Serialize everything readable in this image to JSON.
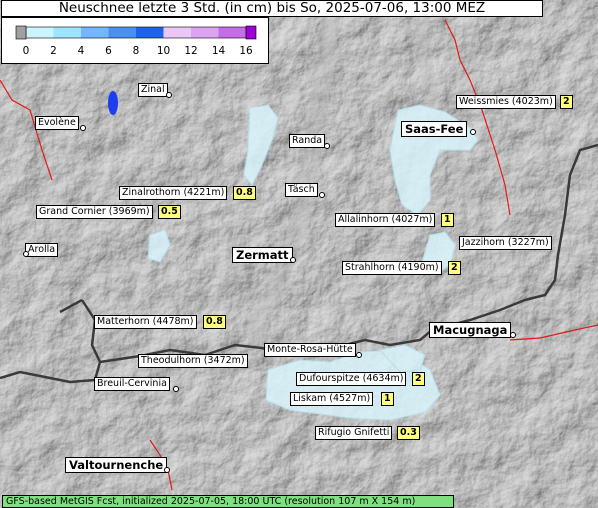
{
  "title": "Neuschnee letzte 3 Std. (in cm) bis So, 2025-07-06, 13:00 MEZ",
  "legend": {
    "ticks": [
      "0",
      "2",
      "4",
      "6",
      "8",
      "10",
      "12",
      "14",
      "16"
    ],
    "colors": [
      "#a0a0a0",
      "#ccf4ff",
      "#9ee4ff",
      "#73b8ff",
      "#4a90f0",
      "#1e64e6",
      "#ebc7f5",
      "#dca3f0",
      "#c36ee6",
      "#9b00d7"
    ]
  },
  "places": {
    "zinal": "Zinal",
    "evolene": "Evolène",
    "weissmies": "Weissmies (4023m)",
    "saas_fee": "Saas-Fee",
    "randa": "Randa",
    "zinalrothorn": "Zinalrothorn (4221m)",
    "tasch": "Täsch",
    "grand_cornier": "Grand Cornier (3969m)",
    "allalinhorn": "Allalinhorn (4027m)",
    "jazzihorn": "Jazzihorn (3227m)",
    "arolla": "Arolla",
    "zermatt": "Zermatt",
    "strahlhorn": "Strahlhorn (4190m)",
    "matterhorn": "Matterhorn (4478m)",
    "macugnaga": "Macugnaga",
    "monte_rosa_hutte": "Monte-Rosa-Hütte",
    "theodulhorn": "Theodulhorn (3472m)",
    "dufourspitze": "Dufourspitze (4634m)",
    "breuil_cervinia": "Breuil-Cervinia",
    "liskam": "Liskam (4527m)",
    "rifugio_gnifetti": "Rifugio Gnifetti",
    "valtournenche": "Valtournenche"
  },
  "snow_values_cm": {
    "weissmies": "2",
    "zinalrothorn": "0.8",
    "grand_cornier": "0.5",
    "allalinhorn": "1",
    "strahlhorn": "2",
    "matterhorn": "0.8",
    "dufourspitze": "2",
    "liskam": "1",
    "rifugio_gnifetti": "0.3"
  },
  "footer": "GFS-based MetGIS Fcst, initialized 2025-07-05, 18:00 UTC  (resolution 107 m X 154 m)"
}
